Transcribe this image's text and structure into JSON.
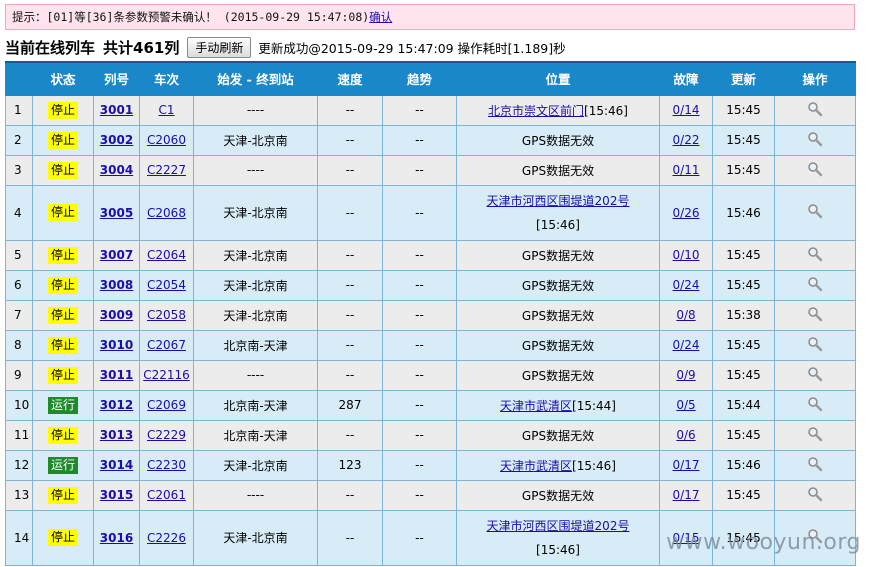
{
  "alert": {
    "prefix": "提示：[01]等[36]条参数预警未确认！ (2015-09-29 15:47:08)",
    "confirm": "确认"
  },
  "header": {
    "title": "当前在线列车",
    "count": "共计461列",
    "refresh_label": "手动刷新",
    "message": "更新成功@2015-09-29 15:47:09 操作耗时[1.189]秒"
  },
  "columns": [
    "",
    "状态",
    "列号",
    "车次",
    "始发 - 终到站",
    "速度",
    "趋势",
    "位置",
    "故障",
    "更新",
    "操作"
  ],
  "rows": [
    {
      "idx": "1",
      "status": "停止",
      "statusType": "stop",
      "trainNo": "3001",
      "trip": "C1",
      "route": "----",
      "speed": "--",
      "trend": "--",
      "locType": "link",
      "loc": "北京市崇文区前门",
      "locTime": "[15:46]",
      "fault": "0/14",
      "updated": "15:45",
      "tall": false
    },
    {
      "idx": "2",
      "status": "停止",
      "statusType": "stop",
      "trainNo": "3002",
      "trip": "C2060",
      "route": "天津-北京南",
      "speed": "--",
      "trend": "--",
      "locType": "text",
      "loc": "GPS数据无效",
      "locTime": "",
      "fault": "0/22",
      "updated": "15:45",
      "tall": false
    },
    {
      "idx": "3",
      "status": "停止",
      "statusType": "stop",
      "trainNo": "3004",
      "trip": "C2227",
      "route": "----",
      "speed": "--",
      "trend": "--",
      "locType": "text",
      "loc": "GPS数据无效",
      "locTime": "",
      "fault": "0/11",
      "updated": "15:45",
      "tall": false
    },
    {
      "idx": "4",
      "status": "停止",
      "statusType": "stop",
      "trainNo": "3005",
      "trip": "C2068",
      "route": "天津-北京南",
      "speed": "--",
      "trend": "--",
      "locType": "link2",
      "loc": "天津市河西区围堤道202号",
      "locTime": "[15:46]",
      "fault": "0/26",
      "updated": "15:46",
      "tall": true
    },
    {
      "idx": "5",
      "status": "停止",
      "statusType": "stop",
      "trainNo": "3007",
      "trip": "C2064",
      "route": "天津-北京南",
      "speed": "--",
      "trend": "--",
      "locType": "text",
      "loc": "GPS数据无效",
      "locTime": "",
      "fault": "0/10",
      "updated": "15:45",
      "tall": false
    },
    {
      "idx": "6",
      "status": "停止",
      "statusType": "stop",
      "trainNo": "3008",
      "trip": "C2054",
      "route": "天津-北京南",
      "speed": "--",
      "trend": "--",
      "locType": "text",
      "loc": "GPS数据无效",
      "locTime": "",
      "fault": "0/24",
      "updated": "15:45",
      "tall": false
    },
    {
      "idx": "7",
      "status": "停止",
      "statusType": "stop",
      "trainNo": "3009",
      "trip": "C2058",
      "route": "天津-北京南",
      "speed": "--",
      "trend": "--",
      "locType": "text",
      "loc": "GPS数据无效",
      "locTime": "",
      "fault": "0/8",
      "updated": "15:38",
      "tall": false
    },
    {
      "idx": "8",
      "status": "停止",
      "statusType": "stop",
      "trainNo": "3010",
      "trip": "C2067",
      "route": "北京南-天津",
      "speed": "--",
      "trend": "--",
      "locType": "text",
      "loc": "GPS数据无效",
      "locTime": "",
      "fault": "0/24",
      "updated": "15:45",
      "tall": false
    },
    {
      "idx": "9",
      "status": "停止",
      "statusType": "stop",
      "trainNo": "3011",
      "trip": "C22116",
      "route": "----",
      "speed": "--",
      "trend": "--",
      "locType": "text",
      "loc": "GPS数据无效",
      "locTime": "",
      "fault": "0/9",
      "updated": "15:45",
      "tall": false
    },
    {
      "idx": "10",
      "status": "运行",
      "statusType": "run",
      "trainNo": "3012",
      "trip": "C2069",
      "route": "北京南-天津",
      "speed": "287",
      "trend": "--",
      "locType": "link",
      "loc": "天津市武清区",
      "locTime": "[15:44]",
      "fault": "0/5",
      "updated": "15:44",
      "tall": false
    },
    {
      "idx": "11",
      "status": "停止",
      "statusType": "stop",
      "trainNo": "3013",
      "trip": "C2229",
      "route": "北京南-天津",
      "speed": "--",
      "trend": "--",
      "locType": "text",
      "loc": "GPS数据无效",
      "locTime": "",
      "fault": "0/6",
      "updated": "15:45",
      "tall": false
    },
    {
      "idx": "12",
      "status": "运行",
      "statusType": "run",
      "trainNo": "3014",
      "trip": "C2230",
      "route": "天津-北京南",
      "speed": "123",
      "trend": "--",
      "locType": "link",
      "loc": "天津市武清区",
      "locTime": "[15:46]",
      "fault": "0/17",
      "updated": "15:46",
      "tall": false
    },
    {
      "idx": "13",
      "status": "停止",
      "statusType": "stop",
      "trainNo": "3015",
      "trip": "C2061",
      "route": "----",
      "speed": "--",
      "trend": "--",
      "locType": "text",
      "loc": "GPS数据无效",
      "locTime": "",
      "fault": "0/17",
      "updated": "15:45",
      "tall": false
    },
    {
      "idx": "14",
      "status": "停止",
      "statusType": "stop",
      "trainNo": "3016",
      "trip": "C2226",
      "route": "天津-北京南",
      "speed": "--",
      "trend": "--",
      "locType": "link2",
      "loc": "天津市河西区围堤道202号",
      "locTime": "[15:46]",
      "fault": "0/15",
      "updated": "15:45",
      "tall": true
    }
  ],
  "watermark": "www.wooyun.org",
  "icons": {
    "action": "magnifier-icon"
  },
  "colors": {
    "header": "#1a87c9",
    "stop": "#ffff00",
    "run": "#1e8a2c",
    "rowOdd": "#ececec",
    "rowEven": "#d8ecf8",
    "alertBg": "#ffe4ee"
  }
}
